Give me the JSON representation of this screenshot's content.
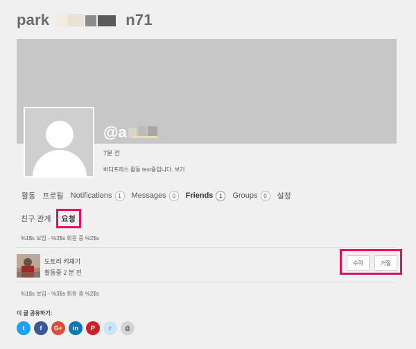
{
  "header": {
    "title_start": "park",
    "title_end": "n71"
  },
  "profile": {
    "handle": "@a",
    "last_active": "7분 전",
    "activity_text": "버디프레스 활동 test중입니다.",
    "activity_link": "보기"
  },
  "nav": {
    "items": [
      {
        "label": "활동",
        "count": null
      },
      {
        "label": "프로필",
        "count": null
      },
      {
        "label": "Notifications",
        "count": "1"
      },
      {
        "label": "Messages",
        "count": "0"
      },
      {
        "label": "Friends",
        "count": "1",
        "current": true
      },
      {
        "label": "Groups",
        "count": "0"
      },
      {
        "label": "설정",
        "count": null
      }
    ]
  },
  "subnav": {
    "friendships": "친구 관계",
    "requests": "요청"
  },
  "pagination": {
    "top": "%1$s 보임 - %3$s 회원 중 %2$s",
    "bottom": "%1$s 보임 - %3$s 회원 중 %2$s"
  },
  "request": {
    "name": "도토리 키재기",
    "meta": "활동중 2 분 전",
    "accept_label": "수락",
    "reject_label": "거절"
  },
  "share": {
    "heading": "이 글 공유하기:",
    "buttons": [
      {
        "name": "twitter-icon",
        "glyph": "t",
        "color": "#1da1f2"
      },
      {
        "name": "facebook-icon",
        "glyph": "f",
        "color": "#3b5998"
      },
      {
        "name": "google-plus-icon",
        "glyph": "G+",
        "color": "#dd4b39"
      },
      {
        "name": "linkedin-icon",
        "glyph": "in",
        "color": "#0976b4"
      },
      {
        "name": "pinterest-icon",
        "glyph": "P",
        "color": "#cb2027"
      },
      {
        "name": "reddit-icon",
        "glyph": "r",
        "color": "#cee3f8"
      },
      {
        "name": "print-icon",
        "glyph": "⎙",
        "color": "#d4d4d4"
      }
    ]
  }
}
